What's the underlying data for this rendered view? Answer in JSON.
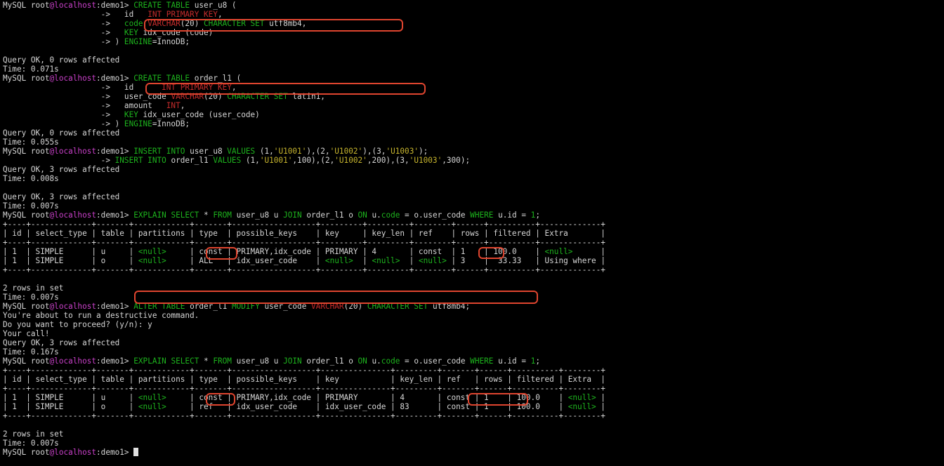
{
  "colors": {
    "background": "#000000",
    "text": "#d6d6d6",
    "host": "#c940c9",
    "keyword": "#1db31d",
    "type": "#c62c2c",
    "value": "#c7b52e",
    "highlight": "#e0452f"
  },
  "lines": [
    [
      {
        "t": "MySQL root"
      },
      {
        "t": "@localhost",
        "c": "pr-host"
      },
      {
        "t": ":demo1> "
      },
      {
        "t": "CREATE TABLE",
        "c": "kw-g"
      },
      {
        "t": " user_u8 ("
      }
    ],
    [
      {
        "t": "                     ->   id   "
      },
      {
        "t": "INT",
        "c": "kw-r"
      },
      {
        "t": " "
      },
      {
        "t": "PRIMARY KEY",
        "c": "kw-r"
      },
      {
        "t": ","
      }
    ],
    [
      {
        "t": "                     ->   "
      },
      {
        "t": "code",
        "c": "kw-g"
      },
      {
        "t": " "
      },
      {
        "t": "VARCHAR",
        "c": "kw-r"
      },
      {
        "t": "(20) "
      },
      {
        "t": "CHARACTER SET",
        "c": "kw-g"
      },
      {
        "t": " utf8mb4,"
      }
    ],
    [
      {
        "t": "                     ->   "
      },
      {
        "t": "KEY",
        "c": "kw-g"
      },
      {
        "t": " idx_code (code)"
      }
    ],
    [
      {
        "t": "                     -> ) "
      },
      {
        "t": "ENGINE",
        "c": "kw-g"
      },
      {
        "t": "=InnoDB;"
      }
    ],
    [
      {
        "t": ""
      }
    ],
    [
      {
        "t": "Query OK, 0 rows affected"
      }
    ],
    [
      {
        "t": "Time: 0.071s"
      }
    ],
    [
      {
        "t": "MySQL root"
      },
      {
        "t": "@localhost",
        "c": "pr-host"
      },
      {
        "t": ":demo1> "
      },
      {
        "t": "CREATE TABLE",
        "c": "kw-g"
      },
      {
        "t": " order_l1 ("
      }
    ],
    [
      {
        "t": "                     ->   id      "
      },
      {
        "t": "INT PRIMARY KEY",
        "c": "kw-r"
      },
      {
        "t": ","
      }
    ],
    [
      {
        "t": "                     ->   user_code "
      },
      {
        "t": "VARCHAR",
        "c": "kw-r"
      },
      {
        "t": "(20) "
      },
      {
        "t": "CHARACTER SET",
        "c": "kw-g"
      },
      {
        "t": " latin1,"
      }
    ],
    [
      {
        "t": "                     ->   amount   "
      },
      {
        "t": "INT",
        "c": "kw-r"
      },
      {
        "t": ","
      }
    ],
    [
      {
        "t": "                     ->   "
      },
      {
        "t": "KEY",
        "c": "kw-g"
      },
      {
        "t": " idx_user_code (user_code)"
      }
    ],
    [
      {
        "t": "                     -> ) "
      },
      {
        "t": "ENGINE",
        "c": "kw-g"
      },
      {
        "t": "=InnoDB;"
      }
    ],
    [
      {
        "t": "Query OK, 0 rows affected"
      }
    ],
    [
      {
        "t": "Time: 0.055s"
      }
    ],
    [
      {
        "t": "MySQL root"
      },
      {
        "t": "@localhost",
        "c": "pr-host"
      },
      {
        "t": ":demo1> "
      },
      {
        "t": "INSERT INTO",
        "c": "kw-g"
      },
      {
        "t": " user_u8 "
      },
      {
        "t": "VALUES",
        "c": "kw-g"
      },
      {
        "t": " (1,"
      },
      {
        "t": "'U1001'",
        "c": "kw-y"
      },
      {
        "t": "),(2,"
      },
      {
        "t": "'U1002'",
        "c": "kw-y"
      },
      {
        "t": "),(3,"
      },
      {
        "t": "'U1003'",
        "c": "kw-y"
      },
      {
        "t": ");"
      }
    ],
    [
      {
        "t": "                     -> "
      },
      {
        "t": "INSERT INTO",
        "c": "kw-g"
      },
      {
        "t": " order_l1 "
      },
      {
        "t": "VALUES",
        "c": "kw-g"
      },
      {
        "t": " (1,"
      },
      {
        "t": "'U1001'",
        "c": "kw-y"
      },
      {
        "t": ",100),(2,"
      },
      {
        "t": "'U1002'",
        "c": "kw-y"
      },
      {
        "t": ",200),(3,"
      },
      {
        "t": "'U1003'",
        "c": "kw-y"
      },
      {
        "t": ",300);"
      }
    ],
    [
      {
        "t": "Query OK, 3 rows affected"
      }
    ],
    [
      {
        "t": "Time: 0.008s"
      }
    ],
    [
      {
        "t": ""
      }
    ],
    [
      {
        "t": "Query OK, 3 rows affected"
      }
    ],
    [
      {
        "t": "Time: 0.007s"
      }
    ],
    [
      {
        "t": "MySQL root"
      },
      {
        "t": "@localhost",
        "c": "pr-host"
      },
      {
        "t": ":demo1> "
      },
      {
        "t": "EXPLAIN SELECT",
        "c": "kw-g"
      },
      {
        "t": " * "
      },
      {
        "t": "FROM",
        "c": "kw-g"
      },
      {
        "t": " user_u8 u "
      },
      {
        "t": "JOIN",
        "c": "kw-g"
      },
      {
        "t": " order_l1 o "
      },
      {
        "t": "ON",
        "c": "kw-g"
      },
      {
        "t": " u."
      },
      {
        "t": "code",
        "c": "kw-g"
      },
      {
        "t": " = o.user_code "
      },
      {
        "t": "WHERE",
        "c": "kw-g"
      },
      {
        "t": " u.id = "
      },
      {
        "t": "1",
        "c": "kw-g"
      },
      {
        "t": ";"
      }
    ],
    [
      {
        "t": "+----+-------------+-------+------------+-------+------------------+---------+---------+--------+------+----------+-------------+"
      }
    ],
    [
      {
        "t": "| id | select_type | table | partitions | type  | possible_keys    | key     | key_len | ref    | rows | filtered | Extra       |"
      }
    ],
    [
      {
        "t": "+----+-------------+-------+------------+-------+------------------+---------+---------+--------+------+----------+-------------+"
      }
    ],
    [
      {
        "t": "| 1  | SIMPLE      | u     | "
      },
      {
        "t": "<null>",
        "c": "kw-g"
      },
      {
        "t": "     | const | PRIMARY,idx_code | PRIMARY | 4       | const  | 1    | 100.0    | "
      },
      {
        "t": "<null>",
        "c": "kw-g"
      },
      {
        "t": "      |"
      }
    ],
    [
      {
        "t": "| 1  | SIMPLE      | o     | "
      },
      {
        "t": "<null>",
        "c": "kw-g"
      },
      {
        "t": "     | ALL   | idx_user_code    | "
      },
      {
        "t": "<null>",
        "c": "kw-g"
      },
      {
        "t": "  | "
      },
      {
        "t": "<null>",
        "c": "kw-g"
      },
      {
        "t": "  | "
      },
      {
        "t": "<null>",
        "c": "kw-g"
      },
      {
        "t": " | 3    |  33.33   | Using where |"
      }
    ],
    [
      {
        "t": "+----+-------------+-------+------------+-------+------------------+---------+---------+--------+------+----------+-------------+"
      }
    ],
    [
      {
        "t": ""
      }
    ],
    [
      {
        "t": "2 rows in set"
      }
    ],
    [
      {
        "t": "Time: 0.007s"
      }
    ],
    [
      {
        "t": "MySQL root"
      },
      {
        "t": "@localhost",
        "c": "pr-host"
      },
      {
        "t": ":demo1> "
      },
      {
        "t": "ALTER TABLE",
        "c": "kw-g"
      },
      {
        "t": " order_l1 "
      },
      {
        "t": "MODIFY",
        "c": "kw-g"
      },
      {
        "t": " user_code "
      },
      {
        "t": "VARCHAR",
        "c": "kw-r"
      },
      {
        "t": "(20) "
      },
      {
        "t": "CHARACTER SET",
        "c": "kw-g"
      },
      {
        "t": " utf8mb4;"
      }
    ],
    [
      {
        "t": "You're about to run a destructive command."
      }
    ],
    [
      {
        "t": "Do you want to proceed? (y/n): y"
      }
    ],
    [
      {
        "t": "Your call!"
      }
    ],
    [
      {
        "t": "Query OK, 3 rows affected"
      }
    ],
    [
      {
        "t": "Time: 0.167s"
      }
    ],
    [
      {
        "t": "MySQL root"
      },
      {
        "t": "@localhost",
        "c": "pr-host"
      },
      {
        "t": ":demo1> "
      },
      {
        "t": "EXPLAIN SELECT",
        "c": "kw-g"
      },
      {
        "t": " * "
      },
      {
        "t": "FROM",
        "c": "kw-g"
      },
      {
        "t": " user_u8 u "
      },
      {
        "t": "JOIN",
        "c": "kw-g"
      },
      {
        "t": " order_l1 o "
      },
      {
        "t": "ON",
        "c": "kw-g"
      },
      {
        "t": " u."
      },
      {
        "t": "code",
        "c": "kw-g"
      },
      {
        "t": " = o.user_code "
      },
      {
        "t": "WHERE",
        "c": "kw-g"
      },
      {
        "t": " u.id = "
      },
      {
        "t": "1",
        "c": "kw-g"
      },
      {
        "t": ";"
      }
    ],
    [
      {
        "t": "+----+-------------+-------+------------+-------+------------------+---------------+---------+-------+------+----------+--------+"
      }
    ],
    [
      {
        "t": "| id | select_type | table | partitions | type  | possible_keys    | key           | key_len | ref   | rows | filtered | Extra  |"
      }
    ],
    [
      {
        "t": "+----+-------------+-------+------------+-------+------------------+---------------+---------+-------+------+----------+--------+"
      }
    ],
    [
      {
        "t": "| 1  | SIMPLE      | u     | "
      },
      {
        "t": "<null>",
        "c": "kw-g"
      },
      {
        "t": "     | const | PRIMARY,idx_code | PRIMARY       | 4       | const | 1    | 100.0    | "
      },
      {
        "t": "<null>",
        "c": "kw-g"
      },
      {
        "t": " |"
      }
    ],
    [
      {
        "t": "| 1  | SIMPLE      | o     | "
      },
      {
        "t": "<null>",
        "c": "kw-g"
      },
      {
        "t": "     | ref   | idx_user_code    | idx_user_code | 83      | const | 1    | 100.0    | "
      },
      {
        "t": "<null>",
        "c": "kw-g"
      },
      {
        "t": " |"
      }
    ],
    [
      {
        "t": "+----+-------------+-------+------------+-------+------------------+---------------+---------+-------+------+----------+--------+"
      }
    ],
    [
      {
        "t": ""
      }
    ],
    [
      {
        "t": "2 rows in set"
      }
    ],
    [
      {
        "t": "Time: 0.007s"
      }
    ],
    [
      {
        "t": "MySQL root"
      },
      {
        "t": "@localhost",
        "c": "pr-host"
      },
      {
        "t": ":demo1> "
      },
      {
        "t": "",
        "cursor": true
      }
    ]
  ]
}
